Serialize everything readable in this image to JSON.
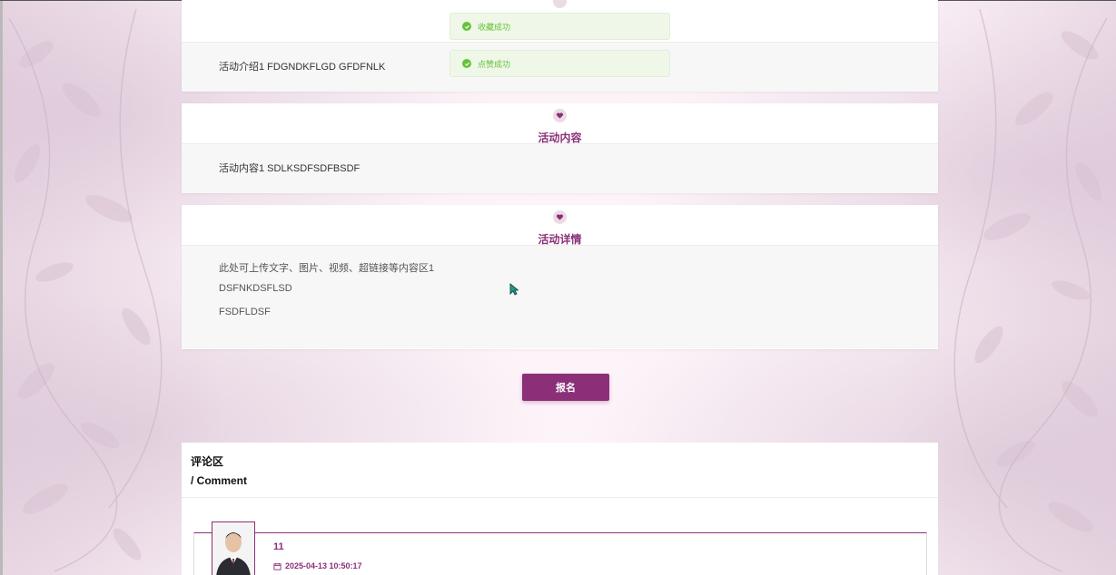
{
  "toasts": {
    "collect": "收藏成功",
    "like": "点赞成功"
  },
  "intro": {
    "text": "活动介绍1 FDGNDKFLGD GFDFNLK"
  },
  "content_section": {
    "title": "活动内容",
    "text": "活动内容1 SDLKSDFSDFBSDF"
  },
  "detail_section": {
    "title": "活动详情",
    "lines": [
      "此处可上传文字、图片、视频、超链接等内容区1",
      "DSFNKDSFLSD",
      "FSDFLDSF"
    ]
  },
  "signup_button": "报名",
  "comments": {
    "title": "评论区",
    "subtitle": "/ Comment",
    "items": [
      {
        "user": "11",
        "time": "2025-04-13 10:50:17"
      }
    ]
  },
  "colors": {
    "accent": "#8b2f78",
    "success": "#67c23a",
    "toast_bg": "#eef7e8"
  },
  "icons": {
    "section": "heart-icon",
    "toast": "check-circle-icon",
    "time": "calendar-icon"
  }
}
